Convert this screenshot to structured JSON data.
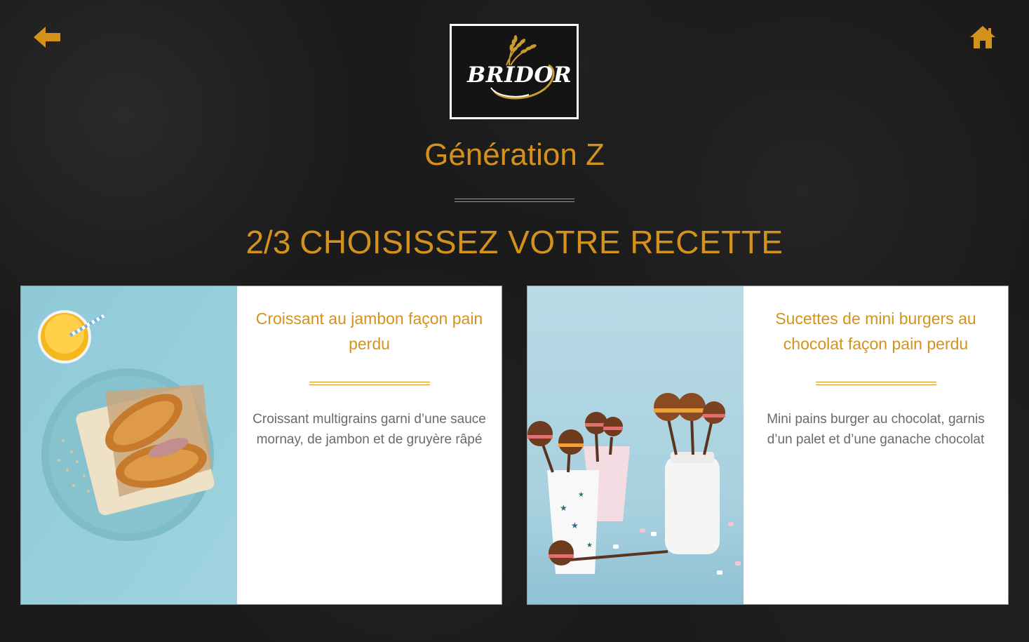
{
  "header": {
    "back_icon": "arrow-left-icon",
    "home_icon": "home-icon",
    "logo_text": "BRIDOR",
    "accent_color": "#d4921d"
  },
  "page": {
    "title": "Génération Z",
    "step_number": "2/3",
    "step_label": "CHOISISSEZ VOTRE RECETTE"
  },
  "recipes": [
    {
      "title": "Croissant au jambon façon pain perdu",
      "description": "Croissant multigrains garni d’une sauce mornay, de jambon et de gruyère râpé",
      "image": "croissant-ham-plate-photo"
    },
    {
      "title": "Sucettes de mini burgers au chocolat façon pain perdu",
      "description": "Mini pains burger au chocolat, garnis d’un palet et d’une ganache chocolat",
      "image": "mini-burger-lollipops-photo"
    }
  ]
}
